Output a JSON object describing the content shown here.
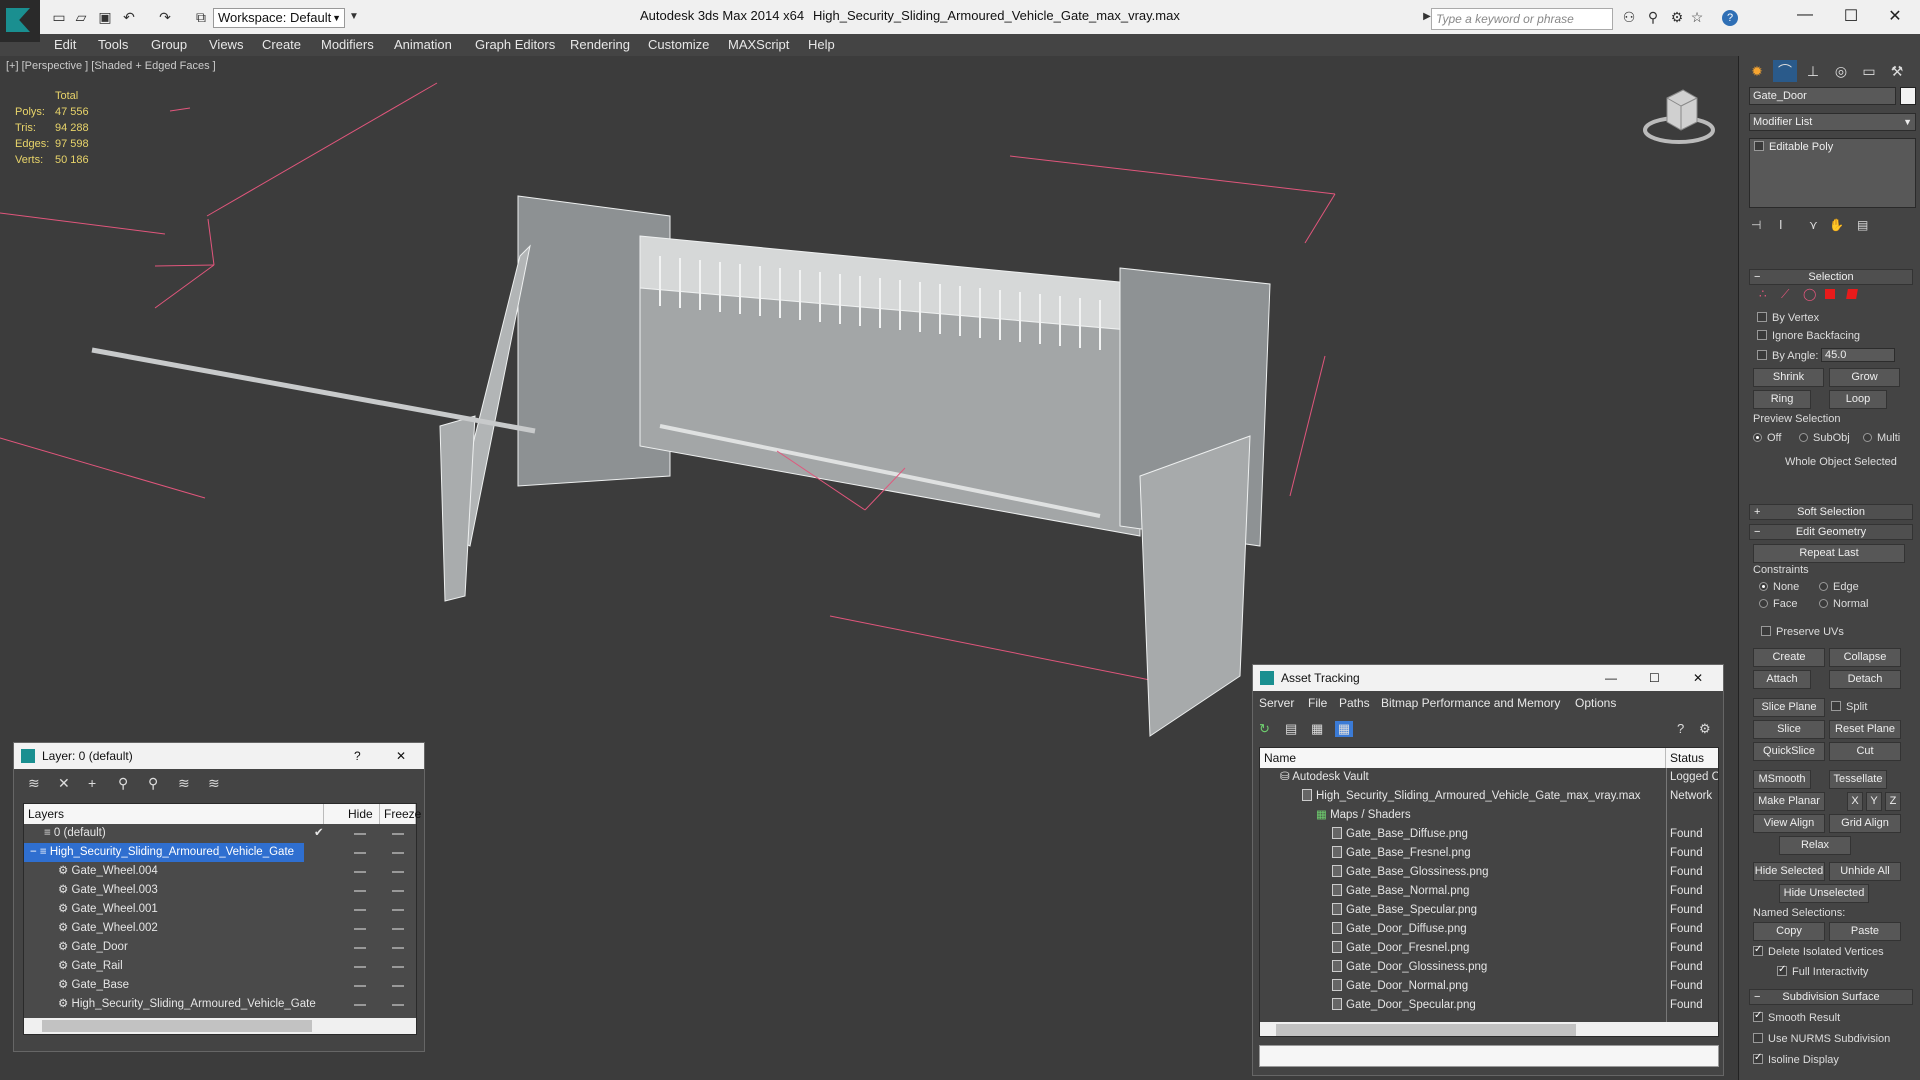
{
  "titlebar": {
    "app_title": "Autodesk 3ds Max  2014 x64",
    "file_title": "High_Security_Sliding_Armoured_Vehicle_Gate_max_vray.max",
    "workspace_label": "Workspace: Default",
    "search_placeholder": "Type a keyword or phrase",
    "help_label": "?",
    "minimize_icon": "minimize-icon",
    "maximize_icon": "maximize-icon",
    "close_icon": "close-icon"
  },
  "menu": [
    "Edit",
    "Tools",
    "Group",
    "Views",
    "Create",
    "Modifiers",
    "Animation",
    "Graph Editors",
    "Rendering",
    "Customize",
    "MAXScript",
    "Help"
  ],
  "viewport": {
    "label": "[+] [Perspective ] [Shaded + Edged Faces ]",
    "stats_header": "Total",
    "stats": [
      {
        "key": "Polys:",
        "value": "47 556"
      },
      {
        "key": "Tris:",
        "value": "94 288"
      },
      {
        "key": "Edges:",
        "value": "97 598"
      },
      {
        "key": "Verts:",
        "value": "50 186"
      }
    ],
    "accent_color": "#e1567c"
  },
  "modify_panel": {
    "object_name": "Gate_Door",
    "modifier_list": "Modifier List",
    "stack_item": "Editable Poly",
    "selection": {
      "title": "Selection",
      "by_vertex": "By Vertex",
      "ignore_backfacing": "Ignore Backfacing",
      "by_angle": "By Angle:",
      "angle_value": "45.0",
      "shrink": "Shrink",
      "grow": "Grow",
      "ring": "Ring",
      "loop": "Loop",
      "preview_selection": "Preview Selection",
      "off": "Off",
      "subobj": "SubObj",
      "multi": "Multi",
      "whole_object": "Whole Object Selected"
    },
    "soft_selection": "Soft Selection",
    "edit_geometry": {
      "title": "Edit Geometry",
      "repeat_last": "Repeat Last",
      "constraints": "Constraints",
      "none": "None",
      "edge": "Edge",
      "face": "Face",
      "normal": "Normal",
      "preserve_uvs": "Preserve UVs",
      "create": "Create",
      "collapse": "Collapse",
      "attach": "Attach",
      "detach": "Detach",
      "slice_plane": "Slice Plane",
      "split": "Split",
      "slice": "Slice",
      "reset_plane": "Reset Plane",
      "quickslice": "QuickSlice",
      "cut": "Cut",
      "msmooth": "MSmooth",
      "tessellate": "Tessellate",
      "make_planar": "Make Planar",
      "x": "X",
      "y": "Y",
      "z": "Z",
      "view_align": "View Align",
      "grid_align": "Grid Align",
      "relax": "Relax",
      "hide_selected": "Hide Selected",
      "unhide_all": "Unhide All",
      "hide_unselected": "Hide Unselected",
      "named_selections": "Named Selections:",
      "copy": "Copy",
      "paste": "Paste",
      "delete_isolated": "Delete Isolated Vertices",
      "full_interactivity": "Full Interactivity"
    },
    "subdivision": {
      "title": "Subdivision Surface",
      "smooth_result": "Smooth Result",
      "use_nurms": "Use NURMS Subdivision",
      "isoline": "Isoline Display"
    }
  },
  "layer_panel": {
    "title": "Layer: 0 (default)",
    "help": "?",
    "col_layers": "Layers",
    "col_hide": "Hide",
    "col_freeze": "Freeze",
    "rows": [
      {
        "name": "0 (default)",
        "level": 0,
        "selected": false
      },
      {
        "name": "High_Security_Sliding_Armoured_Vehicle_Gate",
        "level": 0,
        "selected": true
      },
      {
        "name": "Gate_Wheel.004",
        "level": 1,
        "selected": false
      },
      {
        "name": "Gate_Wheel.003",
        "level": 1,
        "selected": false
      },
      {
        "name": "Gate_Wheel.001",
        "level": 1,
        "selected": false
      },
      {
        "name": "Gate_Wheel.002",
        "level": 1,
        "selected": false
      },
      {
        "name": "Gate_Door",
        "level": 1,
        "selected": false
      },
      {
        "name": "Gate_Rail",
        "level": 1,
        "selected": false
      },
      {
        "name": "Gate_Base",
        "level": 1,
        "selected": false
      },
      {
        "name": "High_Security_Sliding_Armoured_Vehicle_Gate",
        "level": 1,
        "selected": false
      }
    ]
  },
  "asset_panel": {
    "title": "Asset Tracking",
    "menu": [
      "Server",
      "File",
      "Paths",
      "Bitmap Performance and Memory",
      "Options"
    ],
    "col_name": "Name",
    "col_status": "Status",
    "rows": [
      {
        "name": "Autodesk Vault",
        "status": "Logged C",
        "level": 0
      },
      {
        "name": "High_Security_Sliding_Armoured_Vehicle_Gate_max_vray.max",
        "status": "Network",
        "level": 1
      },
      {
        "name": "Maps / Shaders",
        "status": "",
        "level": 2
      },
      {
        "name": "Gate_Base_Diffuse.png",
        "status": "Found",
        "level": 3
      },
      {
        "name": "Gate_Base_Fresnel.png",
        "status": "Found",
        "level": 3
      },
      {
        "name": "Gate_Base_Glossiness.png",
        "status": "Found",
        "level": 3
      },
      {
        "name": "Gate_Base_Normal.png",
        "status": "Found",
        "level": 3
      },
      {
        "name": "Gate_Base_Specular.png",
        "status": "Found",
        "level": 3
      },
      {
        "name": "Gate_Door_Diffuse.png",
        "status": "Found",
        "level": 3
      },
      {
        "name": "Gate_Door_Fresnel.png",
        "status": "Found",
        "level": 3
      },
      {
        "name": "Gate_Door_Glossiness.png",
        "status": "Found",
        "level": 3
      },
      {
        "name": "Gate_Door_Normal.png",
        "status": "Found",
        "level": 3
      },
      {
        "name": "Gate_Door_Specular.png",
        "status": "Found",
        "level": 3
      }
    ]
  }
}
